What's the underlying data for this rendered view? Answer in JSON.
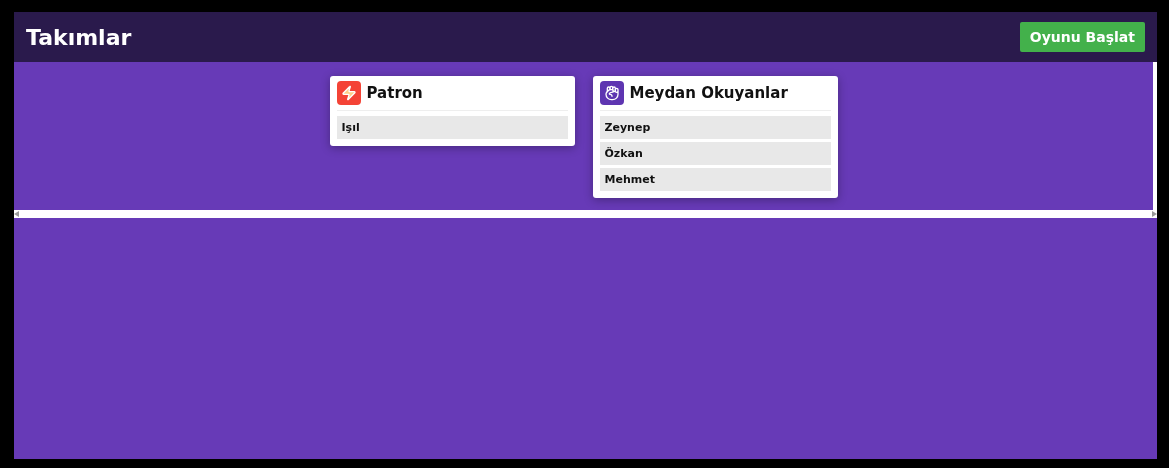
{
  "header": {
    "title": "Takımlar",
    "start_button": "Oyunu Başlat"
  },
  "teams": [
    {
      "name": "Patron",
      "color": "#f44336",
      "members": [
        "Işıl"
      ]
    },
    {
      "name": "Meydan Okuyanlar",
      "color": "#5e35b1",
      "members": [
        "Zeynep",
        "Özkan",
        "Mehmet"
      ]
    }
  ]
}
